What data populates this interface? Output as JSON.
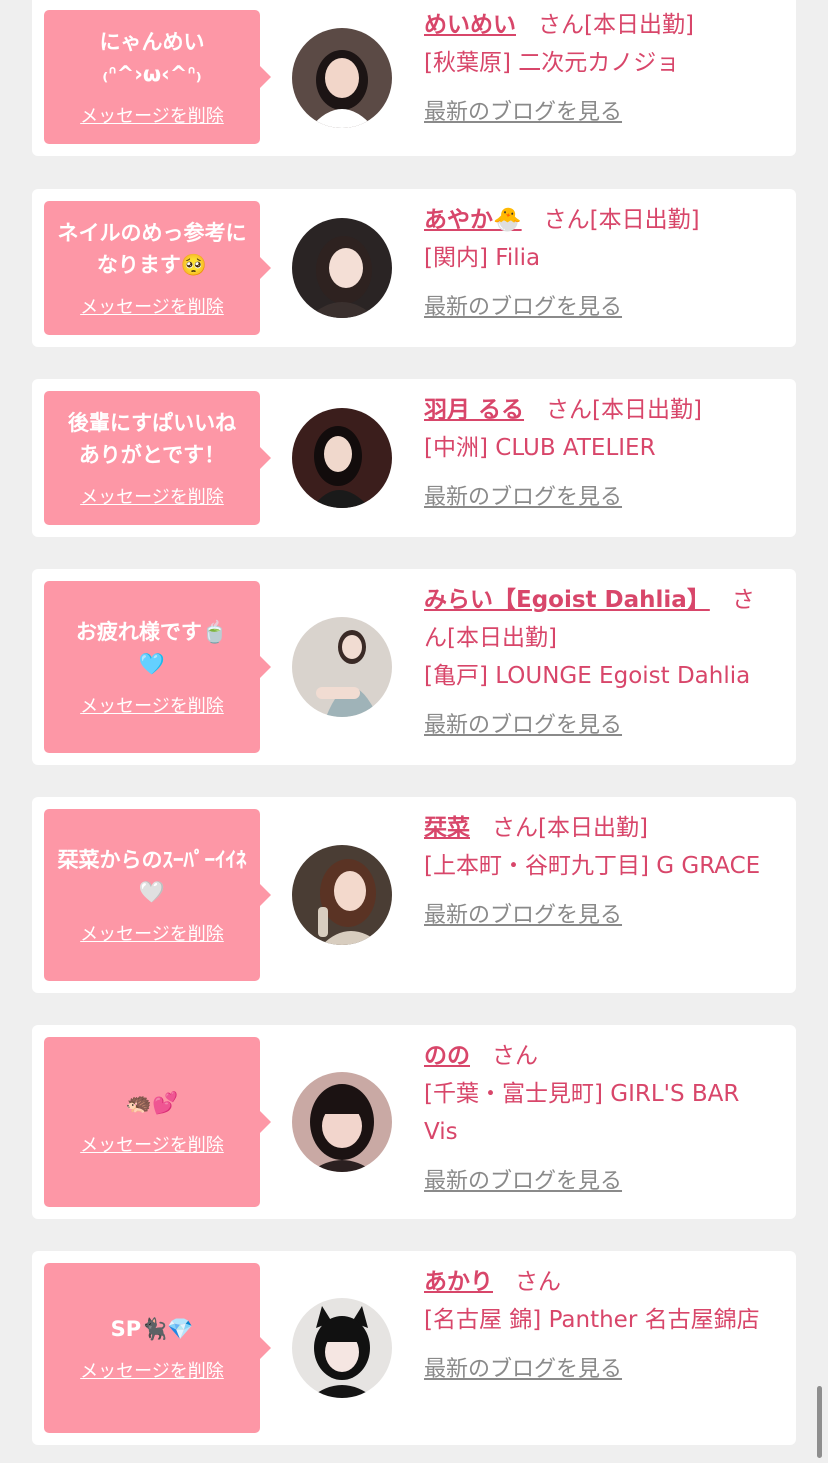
{
  "labels": {
    "delete": "メッセージを削除",
    "view_blog": "最新のブログを見る",
    "honorific": "さん"
  },
  "cards": [
    {
      "message": "にゃんめい\n₍ᐢ^›ω‹^ᐢ₎",
      "name": "めいめい",
      "status": "[本日出勤]",
      "shop": "[秋葉原] 二次元カノジョ",
      "avatar": {
        "bg": "#5b4a45",
        "hair": "#1c1414",
        "clothes": "#ffffff",
        "skin": "#f2d6c9"
      }
    },
    {
      "message": "ネイルのめっ参考になります🥺",
      "name": "あやか🐣",
      "status": "[本日出勤]",
      "shop": "[関内] Filia",
      "avatar": {
        "bg": "#2a2424",
        "hair": "#2e2220",
        "clothes": "#3a302e",
        "skin": "#f4dfd6"
      }
    },
    {
      "message": "後輩にすぱいいね\nありがとです！",
      "name": "羽月 るる",
      "status": "[本日出勤]",
      "shop": "[中洲] CLUB ATELIER",
      "avatar": {
        "bg": "#3b1e1c",
        "hair": "#120c0c",
        "clothes": "#1a1a1a",
        "skin": "#f0d8cc"
      }
    },
    {
      "message": "お疲れ様です🍵\n🩵",
      "name": "みらい【Egoist Dahlia】",
      "status": "[本日出勤]",
      "shop": "[亀戸] LOUNGE Egoist Dahlia",
      "avatar": {
        "bg": "#d9d3cd",
        "hair": "#3a2a26",
        "clothes": "#9fb3b8",
        "skin": "#f1dcd2"
      }
    },
    {
      "message": "栞菜からのｽｰﾊﾟｰｲｲﾈ🤍",
      "name": "栞菜",
      "status": "[本日出勤]",
      "shop": "[上本町・谷町九丁目] G GRACE",
      "avatar": {
        "bg": "#4a3d34",
        "hair": "#5a3324",
        "clothes": "#d8cdbf",
        "skin": "#f3d9cc"
      }
    },
    {
      "message": "🦔💕",
      "name": "のの",
      "status": "",
      "shop": "[千葉・富士見町] GIRL'S BAR Vis",
      "avatar": {
        "bg": "#c9a9a4",
        "hair": "#1b1212",
        "clothes": "#2b2020",
        "skin": "#f2d5cc"
      }
    },
    {
      "message": "SP🐈‍⬛💎",
      "name": "あかり",
      "status": "",
      "shop": "[名古屋 錦] Panther 名古屋錦店",
      "avatar": {
        "bg": "#e6e4e2",
        "hair": "#111111",
        "clothes": "#151515",
        "skin": "#f5e6e2"
      }
    }
  ]
}
